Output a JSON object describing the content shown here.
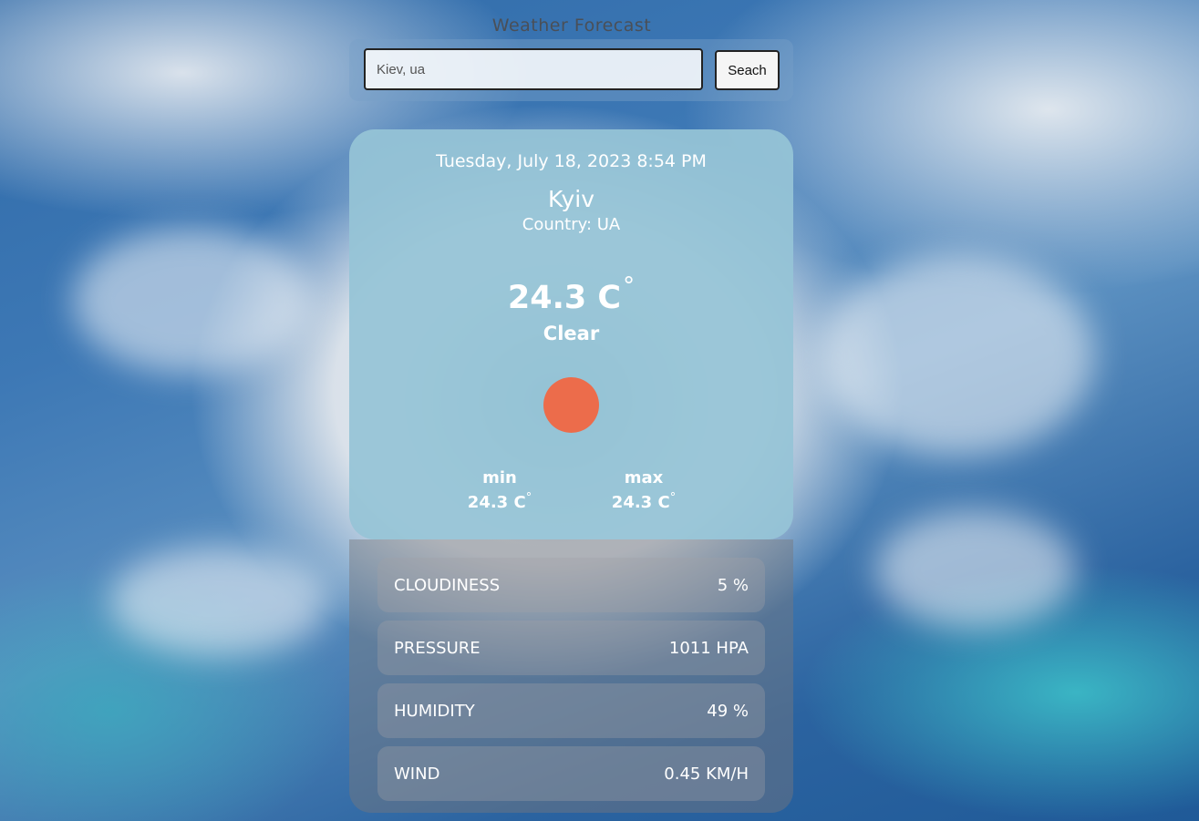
{
  "app_title": "Weather Forecast",
  "search": {
    "value": "Kiev, ua",
    "button_label": "Seach"
  },
  "weather": {
    "datetime": "Tuesday, July 18, 2023 8:54 PM",
    "city": "Kyiv",
    "country": "Country: UA",
    "temperature": "24.3 C",
    "degree_symbol": "°",
    "condition": "Clear",
    "icon": "sun-icon",
    "min_label": "min",
    "min_value": "24.3 C",
    "max_label": "max",
    "max_value": "24.3 C"
  },
  "details": [
    {
      "label": "CLOUDINESS",
      "value": "5 %"
    },
    {
      "label": "PRESSURE",
      "value": "1011 HPA"
    },
    {
      "label": "HUMIDITY",
      "value": "49 %"
    },
    {
      "label": "WIND",
      "value": "0.45 KM/H"
    }
  ],
  "colors": {
    "sun": "#ec6c4b",
    "card": "#96c4d6"
  }
}
